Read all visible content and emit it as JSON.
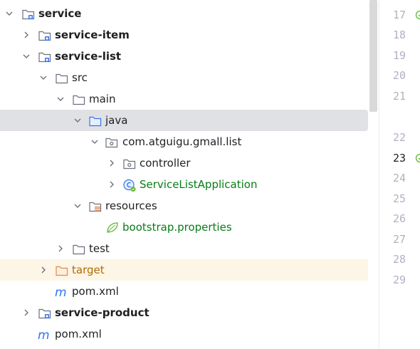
{
  "project_tree": {
    "items": [
      {
        "label": "service"
      },
      {
        "label": "service-item"
      },
      {
        "label": "service-list"
      },
      {
        "label": "src"
      },
      {
        "label": "main"
      },
      {
        "label": "java"
      },
      {
        "label": "com.atguigu.gmall.list"
      },
      {
        "label": "controller"
      },
      {
        "label": "ServiceListApplication"
      },
      {
        "label": "resources"
      },
      {
        "label": "bootstrap.properties"
      },
      {
        "label": "test"
      },
      {
        "label": "target"
      },
      {
        "label": "pom.xml"
      },
      {
        "label": "service-product"
      },
      {
        "label": "pom.xml"
      }
    ],
    "selected_item": "java",
    "icons": {
      "module": "module-folder-icon",
      "folder": "folder-icon",
      "source_root": "source-root-folder-icon",
      "package": "package-icon",
      "spring_class": "spring-boot-class-icon",
      "resources_root": "resources-root-folder-icon",
      "properties": "spring-properties-icon",
      "excluded": "excluded-folder-icon",
      "maven": "maven-pom-icon"
    }
  },
  "editor_gutter": {
    "line_numbers": [
      "17",
      "18",
      "19",
      "20",
      "21",
      "22",
      "23",
      "24",
      "25",
      "26",
      "27",
      "28",
      "29"
    ],
    "current_line": "23"
  },
  "colors": {
    "selection": "#dfe1e5",
    "excluded_row": "#fdf5e6",
    "green_text": "#067d17",
    "orange_text": "#b36a00",
    "folder_stroke": "#6c707e",
    "source_root": "#3574f0",
    "spring_green": "#5fb832"
  }
}
